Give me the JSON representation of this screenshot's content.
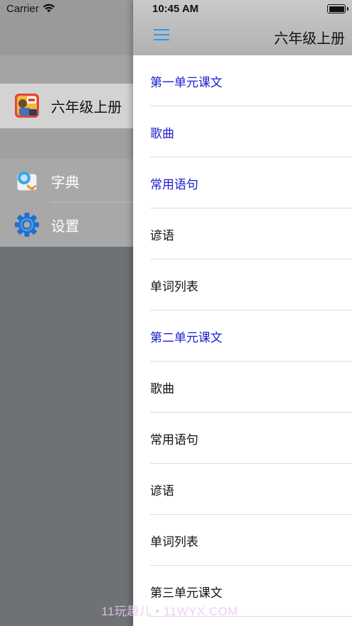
{
  "status": {
    "carrier": "Carrier",
    "time": "10:45 AM"
  },
  "drawer": {
    "book": {
      "label": "六年级上册"
    },
    "menu": [
      {
        "label": "字典"
      },
      {
        "label": "设置"
      }
    ]
  },
  "header": {
    "title": "六年级上册"
  },
  "list": [
    {
      "label": "第一单元课文",
      "style": "blue"
    },
    {
      "label": "歌曲",
      "style": "blue"
    },
    {
      "label": "常用语句",
      "style": "blue"
    },
    {
      "label": "谚语",
      "style": "black"
    },
    {
      "label": "单词列表",
      "style": "black"
    },
    {
      "label": "第二单元课文",
      "style": "blue"
    },
    {
      "label": "歌曲",
      "style": "black"
    },
    {
      "label": "常用语句",
      "style": "black"
    },
    {
      "label": "谚语",
      "style": "black"
    },
    {
      "label": "单词列表",
      "style": "black"
    },
    {
      "label": "第三单元课文",
      "style": "black"
    }
  ],
  "watermark": "11玩趣儿 • 11WYX.COM",
  "colors": {
    "link_blue": "#1c1cd0",
    "hamburger_blue": "#2b9af3"
  },
  "icons": [
    "wifi-icon",
    "battery-icon",
    "hamburger-menu-icon",
    "book-cover-icon",
    "dictionary-icon",
    "gear-icon"
  ]
}
